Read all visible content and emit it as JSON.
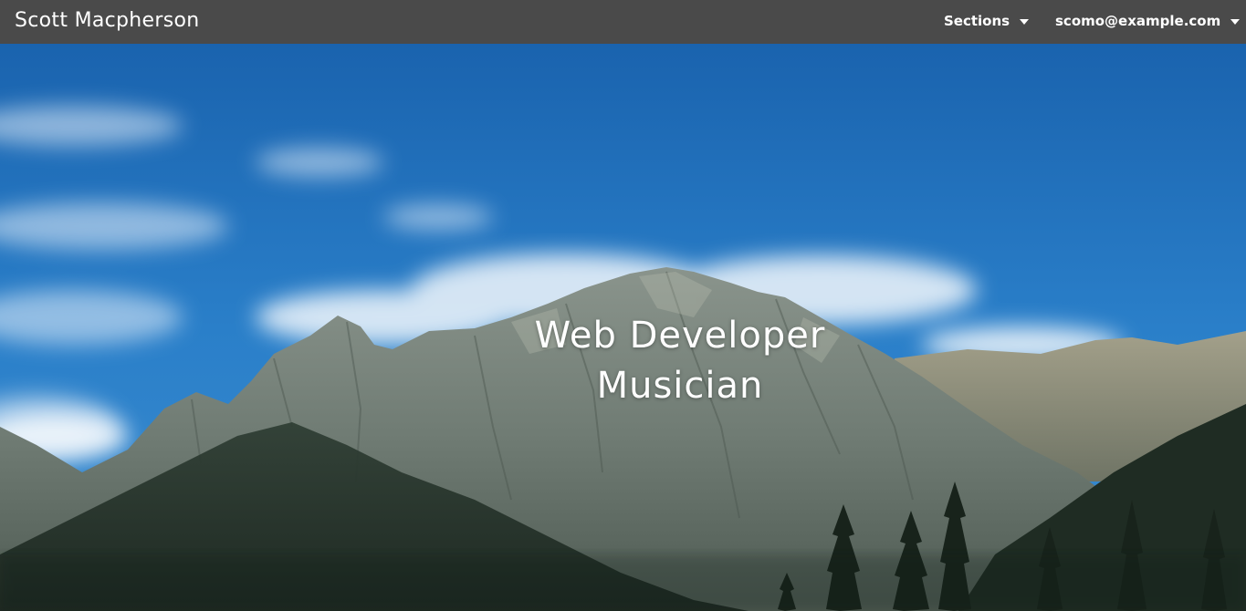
{
  "navbar": {
    "brand": "Scott Macpherson",
    "sections_label": "Sections",
    "user_label": "scomo@example.com"
  },
  "hero": {
    "line1": "Web Developer",
    "line2": "Musician"
  },
  "colors": {
    "navbar_bg": "#4a4a4a",
    "text": "#ffffff",
    "sky": "#1e6fb8"
  },
  "icons": {
    "sections_caret": "caret-down-icon",
    "user_caret": "caret-down-icon"
  }
}
